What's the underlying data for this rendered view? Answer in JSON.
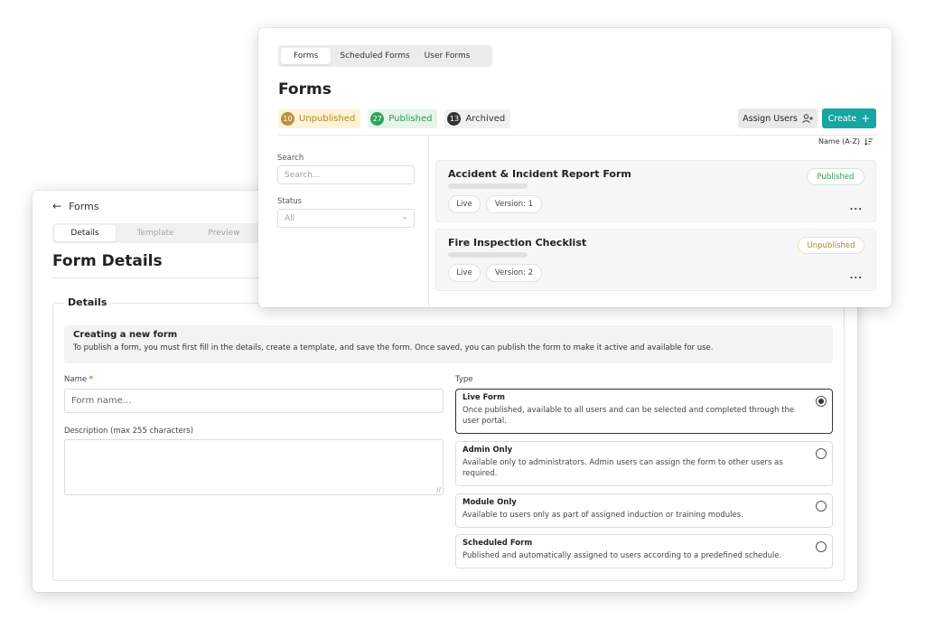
{
  "details": {
    "back_label": "Forms",
    "tabs": [
      {
        "label": "Details"
      },
      {
        "label": "Template"
      },
      {
        "label": "Preview"
      }
    ],
    "title": "Form Details",
    "section_label": "Details",
    "info_title": "Creating a new form",
    "info_text": "To publish a form, you must first fill in the details, create a template, and save the form. Once saved, you can publish the form to make it active and available for use.",
    "name_label": "Name",
    "name_required": "*",
    "name_placeholder": "Form name...",
    "description_label": "Description (max 255 characters)",
    "type_label": "Type",
    "types": [
      {
        "title": "Live Form",
        "desc": "Once published, available to all users and can be selected and completed through the user portal.",
        "selected": true
      },
      {
        "title": "Admin Only",
        "desc": "Available only to administrators. Admin users can assign the form to other users as required.",
        "selected": false
      },
      {
        "title": "Module Only",
        "desc": "Available to users only as part of assigned induction or training modules.",
        "selected": false
      },
      {
        "title": "Scheduled Form",
        "desc": "Published and automatically assigned to users according to a predefined schedule.",
        "selected": false
      }
    ]
  },
  "forms": {
    "tabs": [
      {
        "label": "Forms"
      },
      {
        "label": "Scheduled Forms"
      },
      {
        "label": "User Forms"
      }
    ],
    "title": "Forms",
    "badges": {
      "unpublished": {
        "count": "10",
        "label": "Unpublished"
      },
      "published": {
        "count": "27",
        "label": "Published"
      },
      "archived": {
        "count": "13",
        "label": "Archived"
      }
    },
    "assign_label": "Assign Users",
    "create_label": "Create",
    "search_label": "Search",
    "search_placeholder": "Search...",
    "status_label": "Status",
    "status_value": "All",
    "sort_label": "Name (A-Z)",
    "items": [
      {
        "name": "Accident & Incident Report Form",
        "status": "Published",
        "type": "Live",
        "version": "Version: 1"
      },
      {
        "name": "Fire Inspection Checklist",
        "status": "Unpublished",
        "type": "Live",
        "version": "Version: 2"
      }
    ],
    "more_label": "..."
  },
  "colors": {
    "accent": "#17a5a1",
    "published": "#2f9a55",
    "unpublished": "#b08a1e"
  }
}
